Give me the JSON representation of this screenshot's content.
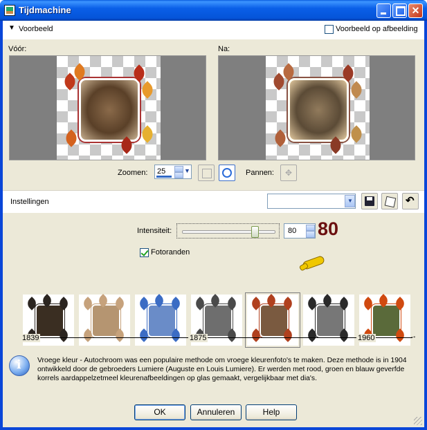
{
  "window": {
    "title": "Tijdmachine"
  },
  "preview_section": {
    "label": "Voorbeeld",
    "preview_on_image_label": "Voorbeeld op afbeelding",
    "before_label": "Vóór:",
    "after_label": "Na:"
  },
  "zoom": {
    "label": "Zoomen:",
    "value": "25",
    "pan_label": "Pannen:"
  },
  "settings": {
    "label": "Instellingen",
    "preset_value": ""
  },
  "intensity": {
    "label": "Intensiteit:",
    "value": "80",
    "slider_fraction": 0.8,
    "annotation": "80"
  },
  "photo_edges": {
    "label": "Fotoranden",
    "checked": true
  },
  "eras": {
    "selected_index": 4,
    "thumbnails": [
      {
        "name": "thumb-1",
        "tone": "#3a2e22",
        "leaf": "#2b2520"
      },
      {
        "name": "thumb-2",
        "tone": "#b59571",
        "leaf": "#c6a27c"
      },
      {
        "name": "thumb-3",
        "tone": "#6a8cc8",
        "leaf": "#3b6cc4"
      },
      {
        "name": "thumb-4",
        "tone": "#6e6e6e",
        "leaf": "#4a4a4a"
      },
      {
        "name": "thumb-5",
        "tone": "#7a5a40",
        "leaf": "#b0401e"
      },
      {
        "name": "thumb-6",
        "tone": "#777777",
        "leaf": "#2a2a2a"
      },
      {
        "name": "thumb-7",
        "tone": "#5a6a3a",
        "leaf": "#d04a10"
      }
    ],
    "timeline": [
      "1839",
      "1875",
      "1960"
    ]
  },
  "description": "Vroege kleur - Autochroom was een populaire methode om vroege kleurenfoto's te maken. Deze methode is in 1904 ontwikkeld door de gebroeders Lumiere (Auguste en Louis Lumiere). Er werden met rood, groen en blauw geverfde korrels aardappelzetmeel kleurenafbeeldingen op glas gemaakt, vergelijkbaar met dia's.",
  "buttons": {
    "ok": "OK",
    "cancel": "Annuleren",
    "help": "Help"
  },
  "colors": {
    "titlebar": "#0a5fe0",
    "panel": "#ece9d8",
    "annotation": "#6b1010"
  }
}
